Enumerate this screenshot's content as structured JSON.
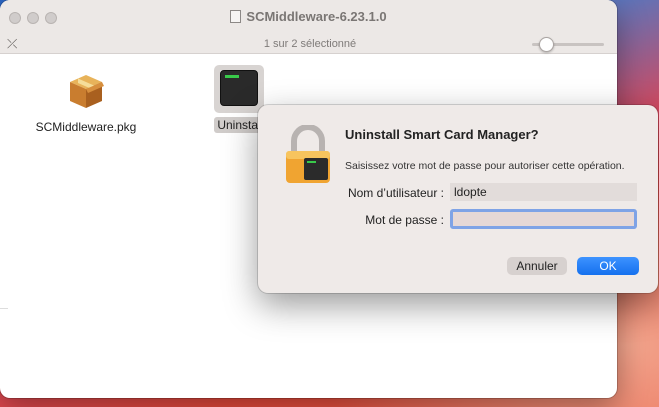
{
  "window": {
    "title": "SCMiddleware-6.23.1.0",
    "status": "1 sur 2 sélectionné"
  },
  "files": [
    {
      "name": "SCMiddleware.pkg",
      "icon": "package-icon"
    },
    {
      "name": "Uninstal",
      "icon": "terminal-icon"
    }
  ],
  "dialog": {
    "title": "Uninstall Smart Card Manager?",
    "message": "Saisissez votre mot de passe pour autoriser cette opération.",
    "username_label": "Nom d’utilisateur :",
    "username_value": "ldopte",
    "password_label": "Mot de passe :",
    "password_value": "",
    "cancel_label": "Annuler",
    "ok_label": "OK"
  },
  "colors": {
    "accent": "#1570ee",
    "focus_ring": "#7fa3e6"
  }
}
